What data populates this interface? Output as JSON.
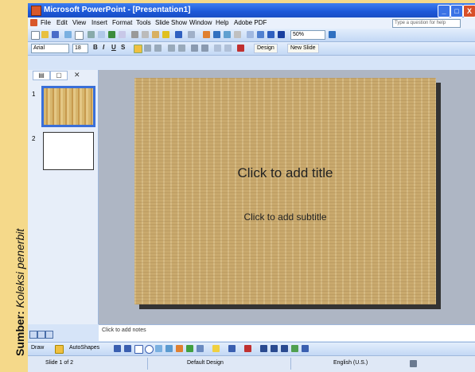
{
  "caption": {
    "label": "Sumber:",
    "text": "Koleksi penerbit"
  },
  "window": {
    "title": "Microsoft PowerPoint - [Presentation1]",
    "controls": {
      "minimize": "_",
      "maximize": "□",
      "close": "X"
    }
  },
  "menu": {
    "items": [
      "File",
      "Edit",
      "View",
      "Insert",
      "Format",
      "Tools",
      "Slide Show",
      "Window",
      "Help",
      "Adobe PDF"
    ],
    "help_placeholder": "Type a question for help"
  },
  "standard_toolbar": {
    "zoom": "50%"
  },
  "formatting_toolbar": {
    "font": "Arial",
    "font_size": "18",
    "bold": "B",
    "italic": "I",
    "underline": "U",
    "shadow": "S",
    "design_button": "Design",
    "new_slide_button": "New Slide"
  },
  "slides_pane": {
    "thumbnails": [
      {
        "number": "1"
      },
      {
        "number": "2"
      }
    ]
  },
  "slide": {
    "title_placeholder": "Click to add title",
    "subtitle_placeholder": "Click to add subtitle"
  },
  "notes": {
    "placeholder": "Click to add notes"
  },
  "drawing_toolbar": {
    "draw_label": "Draw",
    "autoshapes_label": "AutoShapes"
  },
  "status": {
    "slide_position": "Slide 1 of 2",
    "design": "Default Design",
    "language": "English (U.S.)"
  },
  "colors": {
    "accent": "#3a6fd8",
    "titlebar": "#1c58d8",
    "slide_background": "#c9a96d"
  }
}
